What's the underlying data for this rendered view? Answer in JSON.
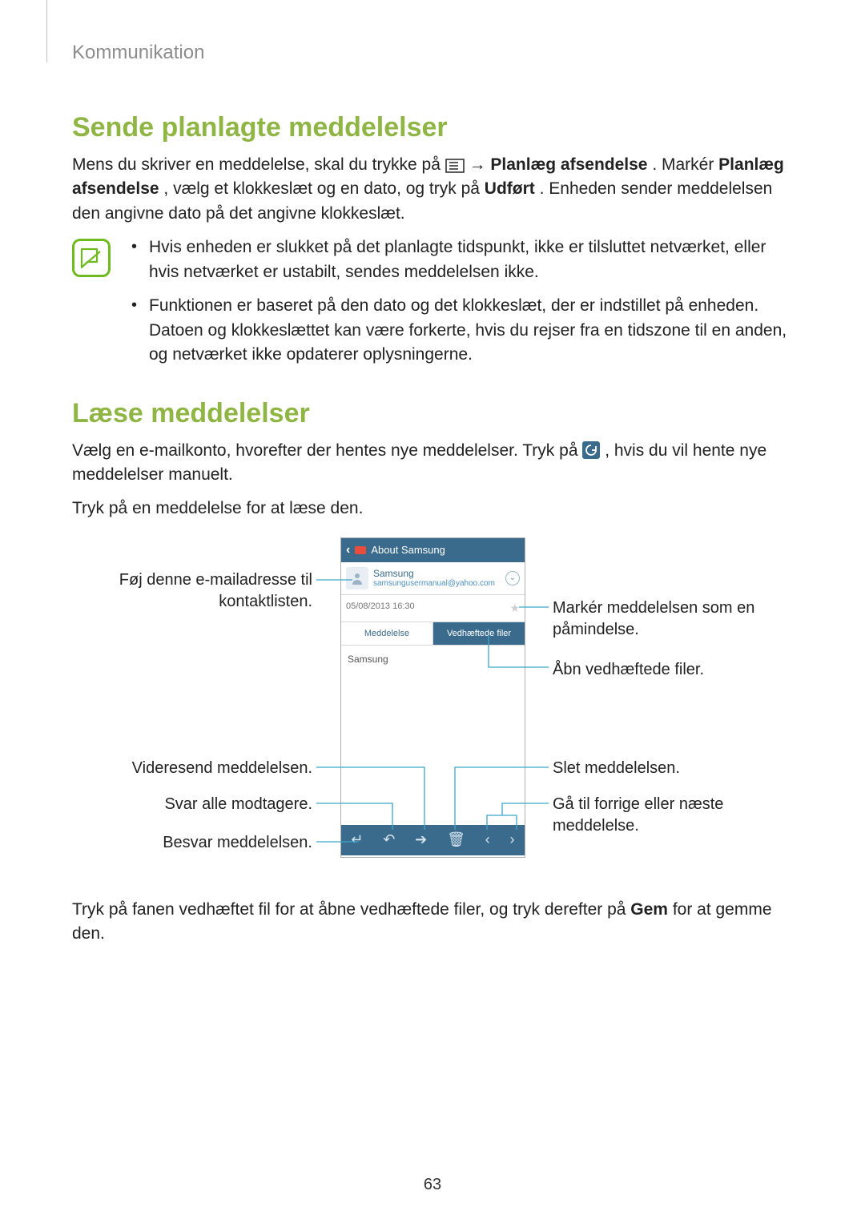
{
  "chapter": "Kommunikation",
  "section1": {
    "title": "Sende planlagte meddelelser",
    "p1_a": "Mens du skriver en meddelelse, skal du trykke på ",
    "p1_b": " → ",
    "p1_c": "Planlæg afsendelse",
    "p1_d": ". Markér ",
    "p1_e": "Planlæg afsendelse",
    "p1_f": ", vælg et klokkeslæt og en dato, og tryk på ",
    "p1_g": "Udført",
    "p1_h": ". Enheden sender meddelelsen den angivne dato på det angivne klokkeslæt.",
    "note1": "Hvis enheden er slukket på det planlagte tidspunkt, ikke er tilsluttet netværket, eller hvis netværket er ustabilt, sendes meddelelsen ikke.",
    "note2": "Funktionen er baseret på den dato og det klokkeslæt, der er indstillet på enheden. Datoen og klokkeslættet kan være forkerte, hvis du rejser fra en tidszone til en anden, og netværket ikke opdaterer oplysningerne."
  },
  "section2": {
    "title": "Læse meddelelser",
    "p1_a": "Vælg en e-mailkonto, hvorefter der hentes nye meddelelser. Tryk på ",
    "p1_b": ", hvis du vil hente nye meddelelser manuelt.",
    "p2": "Tryk på en meddelelse for at læse den.",
    "p3_a": "Tryk på fanen vedhæftet fil for at åbne vedhæftede filer, og tryk derefter på ",
    "p3_b": "Gem",
    "p3_c": " for at gemme den."
  },
  "figure": {
    "appbar_title": "About Samsung",
    "sender_name": "Samsung",
    "sender_email": "samsungusermanual@yahoo.com",
    "datetime": "05/08/2013  16:30",
    "tab_message": "Meddelelse",
    "tab_attach": "Vedhæftede filer",
    "body_text": "Samsung",
    "callouts": {
      "left1": "Føj denne e-mailadresse til kontaktlisten.",
      "left2": "Videresend meddelelsen.",
      "left3": "Svar alle modtagere.",
      "left4": "Besvar meddelelsen.",
      "right1": "Markér meddelelsen som en påmindelse.",
      "right2": "Åbn vedhæftede filer.",
      "right3": "Slet meddelelsen.",
      "right4": "Gå til forrige eller næste meddelelse."
    }
  },
  "page_number": "63"
}
